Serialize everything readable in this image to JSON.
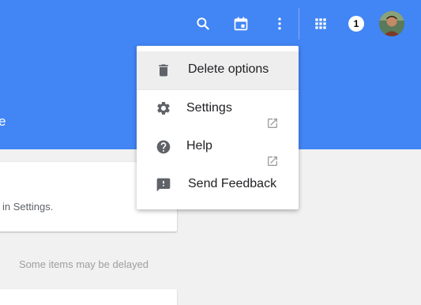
{
  "header": {
    "title_partial": "e",
    "background": "#4285f4"
  },
  "topbar": {
    "icons": [
      "search-icon",
      "calendar-icon",
      "more-vert-icon",
      "apps-icon"
    ],
    "notification_count": "1"
  },
  "card": {
    "text_partial": "in Settings."
  },
  "status": {
    "delayed_text": "Some items may be delayed"
  },
  "menu": {
    "items": [
      {
        "label": "Delete options",
        "icon": "trash-icon",
        "active": true
      },
      {
        "label": "Settings",
        "icon": "gear-icon",
        "external": true
      },
      {
        "label": "Help",
        "icon": "help-circle-icon",
        "external": true
      },
      {
        "label": "Send Feedback",
        "icon": "feedback-icon"
      }
    ]
  }
}
